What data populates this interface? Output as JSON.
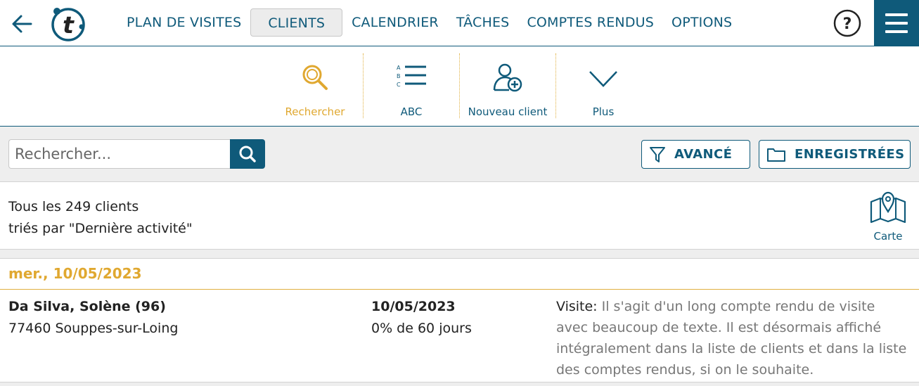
{
  "topbar": {
    "back_icon": "arrow-left-icon",
    "logo_text": "t",
    "nav": [
      {
        "label": "PLAN DE VISITES",
        "active": false
      },
      {
        "label": "CLIENTS",
        "active": true
      },
      {
        "label": "CALENDRIER",
        "active": false
      },
      {
        "label": "TÂCHES",
        "active": false
      },
      {
        "label": "COMPTES RENDUS",
        "active": false
      },
      {
        "label": "OPTIONS",
        "active": false
      }
    ],
    "help_label": "?",
    "menu_icon": "hamburger-icon"
  },
  "toolbar": {
    "search_label": "Rechercher",
    "abc_label": "ABC",
    "abc_letters": [
      "A",
      "B",
      "C"
    ],
    "new_client_label": "Nouveau client",
    "more_label": "Plus"
  },
  "search": {
    "placeholder": "Rechercher...",
    "value": "",
    "advanced_label": "AVANCÉ",
    "saved_label": "ENREGISTRÉES"
  },
  "summary": {
    "line1": "Tous les 249 clients",
    "line2": "triés par \"Dernière activité\"",
    "map_label": "Carte"
  },
  "list": {
    "date_header": "mer., 10/05/2023",
    "rows": [
      {
        "name": "Da Silva, Solène (96)",
        "address": "77460 Souppes-sur-Loing",
        "date": "10/05/2023",
        "progress": "0% de 60 jours",
        "report_type": "Visite:",
        "report_text": " Il s'agit d'un long compte rendu de visite avec beaucoup de texte. Il est désormais affiché intégralement dans la liste de clients et dans la liste des comptes rendus, si on le souhaite."
      }
    ]
  },
  "colors": {
    "primary": "#0f5a7a",
    "accent": "#e0a830",
    "gray_bg": "#eeeeee"
  }
}
